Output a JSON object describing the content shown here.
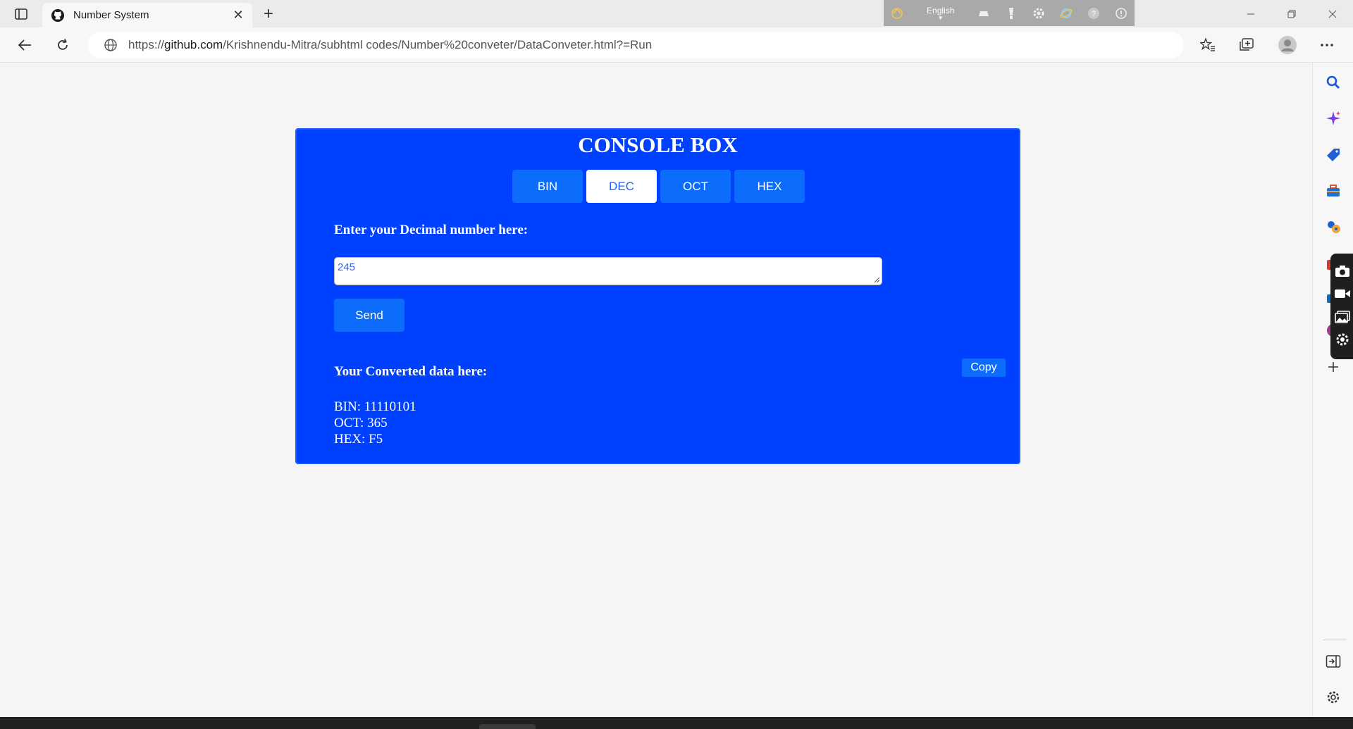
{
  "browser": {
    "tab": {
      "title": "Number System",
      "favicon": "github-icon"
    },
    "ime": {
      "language": "English"
    },
    "url": {
      "prefix": "https://",
      "host": "github.com",
      "path": "/Krishnendu-Mitra/subhtml codes/Number%20conveter/DataConveter.html?=Run"
    }
  },
  "page": {
    "title": "CONSOLE BOX",
    "tabs": [
      {
        "label": "BIN",
        "active": false
      },
      {
        "label": "DEC",
        "active": true
      },
      {
        "label": "OCT",
        "active": false
      },
      {
        "label": "HEX",
        "active": false
      }
    ],
    "input_label": "Enter your Decimal number here:",
    "input_value": "245",
    "send_label": "Send",
    "output_label": "Your Converted data here:",
    "copy_label": "Copy",
    "results": [
      "BIN: 11110101",
      "OCT: 365",
      "HEX: F5"
    ]
  },
  "colors": {
    "console_bg": "#0040ff",
    "button_bg": "#0c6dfd",
    "active_tab_text": "#1e63ff"
  }
}
